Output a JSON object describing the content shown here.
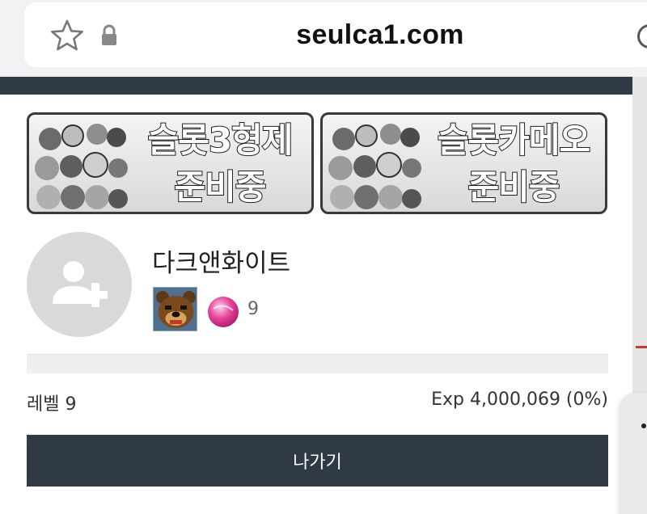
{
  "browser": {
    "url": "seulca1.com",
    "icons": [
      "star-icon",
      "lock-icon",
      "reload-icon"
    ]
  },
  "banners": [
    {
      "line1": "슬롯3형제",
      "line2": "준비중"
    },
    {
      "line1": "슬롯카메오",
      "line2": "준비중"
    }
  ],
  "profile": {
    "avatar_icon": "add-user-icon",
    "username": "다크앤화이트",
    "badge_icon": "bear-badge-icon",
    "candy_icon": "pink-candy-icon",
    "badge_count": "9"
  },
  "level": {
    "label": "레벨 9",
    "exp_text": "Exp 4,000,069 (0%)",
    "exp_progress": 0
  },
  "actions": {
    "exit_label": "나가기"
  },
  "colors": {
    "primary_dark": "#2f3a46",
    "candy_pink": "#e8459a",
    "avatar_bg": "#d9d9d9"
  }
}
